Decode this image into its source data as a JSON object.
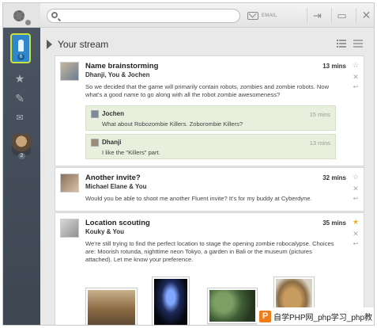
{
  "topbar": {
    "email_label": "EMAIL"
  },
  "rail": {
    "stream_badge": "6",
    "avatar_badge": "2",
    "icons": [
      "gear-icon",
      "person-icon",
      "star-icon",
      "paperclip-icon",
      "mail-icon"
    ]
  },
  "stream": {
    "title": "Your stream",
    "posts": [
      {
        "title": "Name brainstorming",
        "people": "Dhanji, You & Jochen",
        "time": "13 mins",
        "starred": false,
        "body": "So we decided that the game will primarily contain robots, zombies and zombie robots. Now what's a good name to go along with all the robot zombie awesomeness?",
        "replies": [
          {
            "name": "Jochen",
            "time": "15 mins",
            "text": "What about Robozombie Killers. Zoborombie Killers?"
          },
          {
            "name": "Dhanji",
            "time": "13 mins",
            "text": "I like the \"Killers\" part."
          }
        ]
      },
      {
        "title": "Another invite?",
        "people": "Michael Elane & You",
        "time": "32 mins",
        "starred": false,
        "body": "Would you be able to shoot me another Fluent invite? It's for my buddy at Cyberdyne."
      },
      {
        "title": "Location scouting",
        "people": "Kouky & You",
        "time": "35 mins",
        "starred": true,
        "body": "We're still trying to find the perfect location to stage the opening zombie robocalypse. Choices are: Moorish rotunda, nighttime neon Tokyo, a garden in Bali or the museum (pictures attached). Let me know your preference."
      }
    ]
  },
  "colors": {
    "rail": "#434c57",
    "accent_blue": "#2f86c8",
    "accent_green": "#c8e33b",
    "reply_bg": "#e8efdd",
    "star_on": "#f0b21c"
  },
  "watermark": {
    "text": "自学PHP网_php学习_php教"
  }
}
